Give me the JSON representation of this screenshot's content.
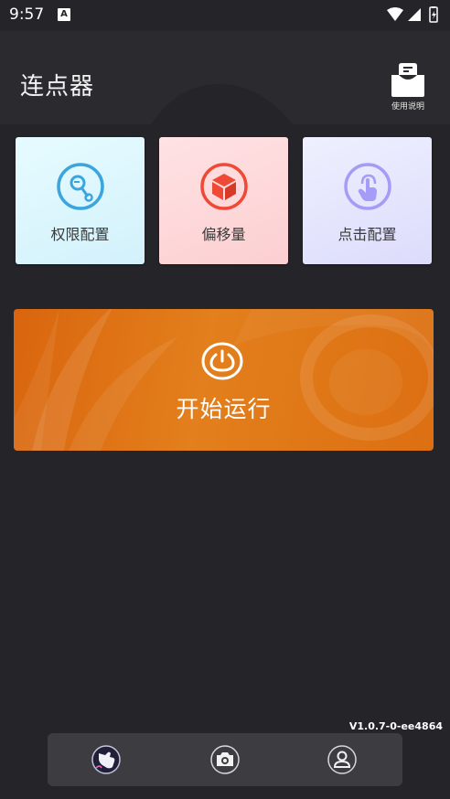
{
  "status": {
    "time": "9:57",
    "notification_badge": "A"
  },
  "header": {
    "title": "连点器",
    "help_label": "使用说明"
  },
  "cards": [
    {
      "label": "权限配置",
      "icon": "key-icon",
      "accent": "#3aa6dd"
    },
    {
      "label": "偏移量",
      "icon": "cube-icon",
      "accent": "#ee4a35"
    },
    {
      "label": "点击配置",
      "icon": "tap-icon",
      "accent": "#a49cf7"
    }
  ],
  "start": {
    "label": "开始运行",
    "icon": "power-icon"
  },
  "version": "V1.0.7-0-ee4864",
  "bottom_nav": [
    {
      "icon": "clicker-hand-icon"
    },
    {
      "icon": "camera-icon"
    },
    {
      "icon": "profile-icon"
    }
  ],
  "colors": {
    "background": "#242429",
    "header": "#2a2a2f",
    "start_panel": "#e07518",
    "nav": "#3c3c41"
  }
}
